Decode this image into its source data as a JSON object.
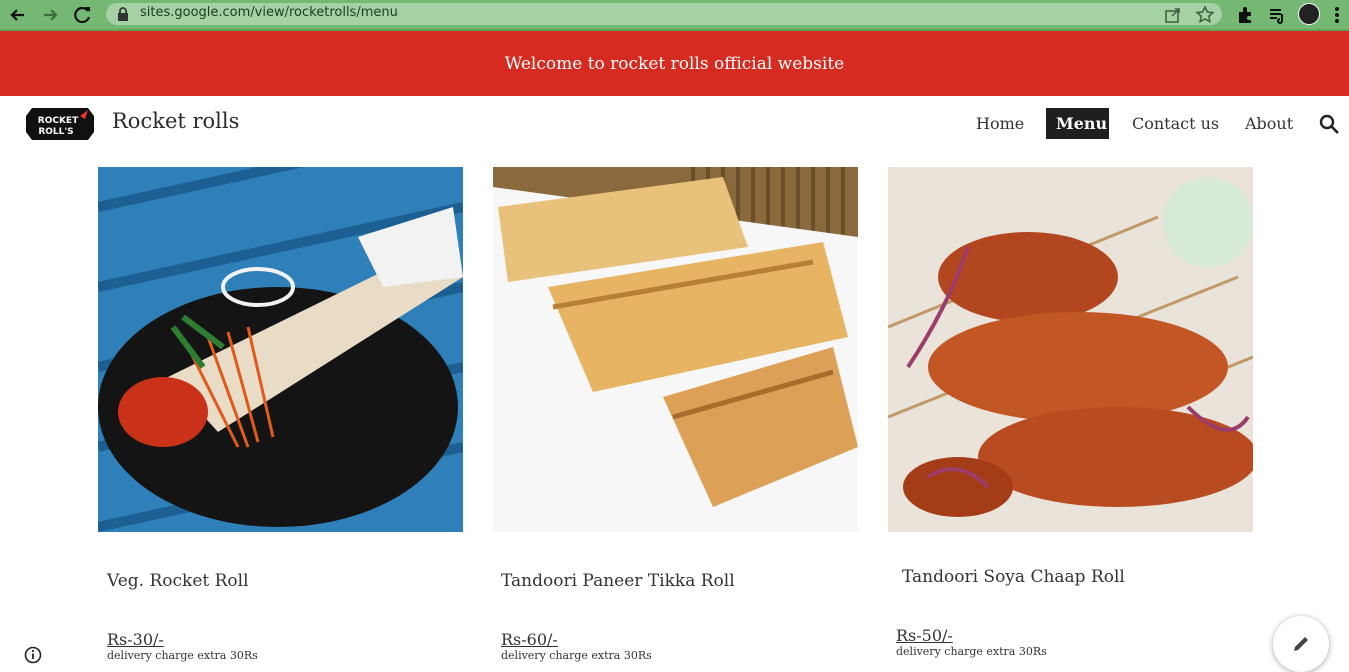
{
  "browser": {
    "url": "sites.google.com/view/rocketrolls/menu",
    "icons": [
      "back-arrow-icon",
      "forward-arrow-icon",
      "reload-icon",
      "lock-icon",
      "share-icon",
      "star-icon",
      "extensions-icon",
      "media-icon",
      "profile-avatar",
      "more-vert-icon"
    ]
  },
  "banner": {
    "text": "Welcome to rocket rolls official website"
  },
  "header": {
    "logo_text": [
      "ROCKET",
      "ROLL'S"
    ],
    "site_title": "Rocket rolls",
    "nav": [
      {
        "label": "Home",
        "active": false
      },
      {
        "label": "Menu",
        "active": true
      },
      {
        "label": "Contact us",
        "active": false
      },
      {
        "label": "About",
        "active": false
      }
    ]
  },
  "menu_items": [
    {
      "name": "Veg. Rocket Roll",
      "price": "Rs-30/-",
      "note": "delivery charge extra 30Rs",
      "image": "veg-rocket-roll-photo"
    },
    {
      "name": "Tandoori Paneer Tikka Roll",
      "price": "Rs-60/-",
      "note": "delivery charge extra 30Rs",
      "image": "paneer-tikka-roll-photo"
    },
    {
      "name": "Tandoori Soya Chaap Roll",
      "price": "Rs-50/-",
      "note": "delivery charge extra 30Rs",
      "image": "soya-chaap-photo"
    }
  ],
  "colors": {
    "browser_bar": "#74b874",
    "banner": "#d52b20",
    "nav_active": "#1f1f1f"
  }
}
